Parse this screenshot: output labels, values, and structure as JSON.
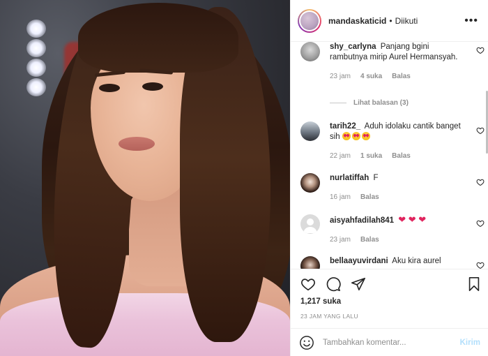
{
  "header": {
    "username": "mandaskaticid",
    "dot": "•",
    "follow_status": "Diikuti",
    "more_icon": "more-horizontal-icon"
  },
  "comments": [
    {
      "user": "shy_carlyna",
      "text": "Panjang bgini rambutnya mirip Aurel Hermansyah.",
      "time": "23 jam",
      "likes": "4 suka",
      "reply": "Balas",
      "view_replies": "Lihat balasan (3)"
    },
    {
      "user": "tarih22_",
      "text": "Aduh idolaku cantik banget sih",
      "emoji_count": 3,
      "time": "22 jam",
      "likes": "1 suka",
      "reply": "Balas"
    },
    {
      "user": "nurlatiffah",
      "text": "F",
      "time": "16 jam",
      "reply": "Balas"
    },
    {
      "user": "aisyahfadilah841",
      "text": "",
      "hearts": "❤ ❤ ❤",
      "time": "23 jam",
      "reply": "Balas"
    },
    {
      "user": "bellaayuvirdani",
      "text": "Aku kira aurel"
    }
  ],
  "actions": {
    "likes": "1,217 suka",
    "time_ago": "23 JAM YANG LALU"
  },
  "add_comment": {
    "placeholder": "Tambahkan komentar...",
    "post_label": "Kirim"
  },
  "colors": {
    "accent": "#0095f6",
    "post_disabled": "#b2dffc",
    "muted": "#8e8e8e",
    "heart_red": "#e0245e"
  }
}
